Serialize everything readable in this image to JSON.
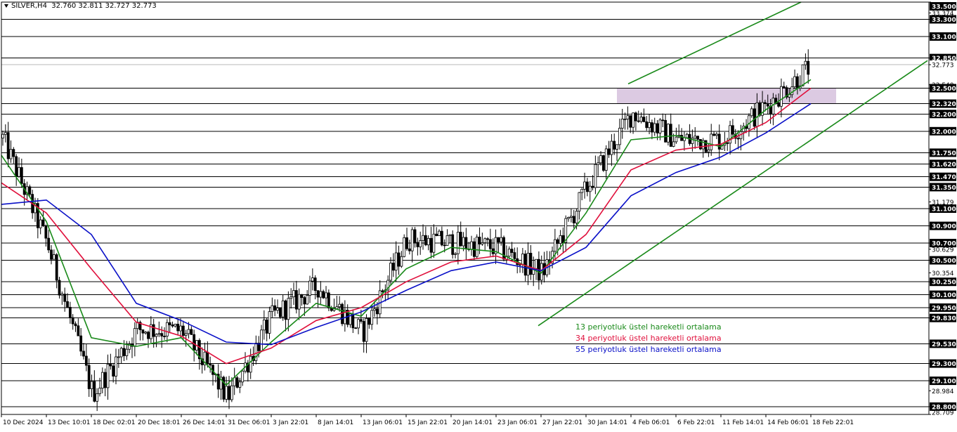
{
  "header": {
    "symbol_timeframe": "SILVER,H4",
    "ohlc": "32.760 32.811 32.727 32.773"
  },
  "legend": [
    {
      "label": "13 periyotluk üstel hareketli ortalama",
      "color": "#1a8a1a"
    },
    {
      "label": "34 periyotluk üstel hareketli ortalama",
      "color": "#e0103c"
    },
    {
      "label": "55 periyotluk üstel hareketli ortalama",
      "color": "#0a10c8"
    }
  ],
  "chart_data": {
    "type": "line",
    "title": "SILVER,H4",
    "ylim": [
      28.709,
      33.5
    ],
    "y_tick_labels": [
      "33.500",
      "33.374",
      "33.300",
      "33.100",
      "32.850",
      "32.773",
      "32.540",
      "32.500",
      "32.320",
      "32.200",
      "32.000",
      "31.750",
      "31.620",
      "31.470",
      "31.350",
      "31.179",
      "31.100",
      "30.900",
      "30.700",
      "30.629",
      "30.500",
      "30.354",
      "30.250",
      "30.100",
      "29.950",
      "29.830",
      "29.530",
      "29.300",
      "29.100",
      "28.984",
      "28.800",
      "28.709"
    ],
    "horizontal_levels": [
      33.5,
      33.3,
      33.1,
      32.85,
      32.5,
      32.32,
      32.2,
      32.0,
      31.75,
      31.62,
      31.47,
      31.35,
      31.1,
      30.9,
      30.7,
      30.5,
      30.25,
      30.1,
      29.95,
      29.83,
      29.53,
      29.3,
      29.1,
      28.8
    ],
    "current_price": 32.773,
    "x_tick_labels": [
      "10 Dec 2024",
      "13 Dec 10:01",
      "18 Dec 02:01",
      "20 Dec 18:01",
      "26 Dec 14:01",
      "31 Dec 06:01",
      "3 Jan 22:01",
      "8 Jan 14:01",
      "13 Jan 06:01",
      "15 Jan 22:01",
      "20 Jan 14:01",
      "23 Jan 06:01",
      "27 Jan 22:01",
      "30 Jan 14:01",
      "4 Feb 06:01",
      "6 Feb 22:01",
      "11 Feb 14:01",
      "14 Feb 06:01",
      "18 Feb 22:01"
    ],
    "resistance_zone": {
      "from": 32.32,
      "to": 32.5,
      "start": "4 Feb 06:01",
      "end": "18 Feb 22:01",
      "color": "#d8c4df"
    },
    "price_path": [
      [
        "10 Dec 2024",
        31.92
      ],
      [
        "13 Dec 10:01",
        30.68
      ],
      [
        "18 Dec 02:01",
        28.95
      ],
      [
        "20 Dec 18:01",
        29.7
      ],
      [
        "26 Dec 14:01",
        29.68
      ],
      [
        "31 Dec 06:01",
        28.9
      ],
      [
        "3 Jan 22:01",
        29.85
      ],
      [
        "8 Jan 14:01",
        30.2
      ],
      [
        "13 Jan 06:01",
        29.65
      ],
      [
        "15 Jan 22:01",
        30.75
      ],
      [
        "20 Jan 14:01",
        30.7
      ],
      [
        "23 Jan 06:01",
        30.65
      ],
      [
        "27 Jan 22:01",
        30.35
      ],
      [
        "30 Jan 14:01",
        31.35
      ],
      [
        "4 Feb 06:01",
        32.22
      ],
      [
        "6 Feb 22:01",
        31.9
      ],
      [
        "11 Feb 14:01",
        31.9
      ],
      [
        "14 Feb 06:01",
        32.3
      ],
      [
        "18 Feb 22:01",
        32.773
      ]
    ],
    "series": [
      {
        "name": "13 periyotluk üstel hareketli ortalama",
        "color": "#1a8a1a",
        "values": [
          31.72,
          30.95,
          29.6,
          29.5,
          29.6,
          29.05,
          29.55,
          30.0,
          29.85,
          30.4,
          30.65,
          30.6,
          30.35,
          31.05,
          31.9,
          31.95,
          31.82,
          32.25,
          32.6
        ]
      },
      {
        "name": "34 periyotluk üstel hareketli ortalama",
        "color": "#e0103c",
        "values": [
          31.4,
          31.05,
          30.4,
          29.78,
          29.62,
          29.3,
          29.48,
          29.8,
          29.95,
          30.25,
          30.48,
          30.55,
          30.38,
          30.8,
          31.55,
          31.78,
          31.85,
          32.1,
          32.5
        ]
      },
      {
        "name": "55 periyotluk üstel hareketli ortalama",
        "color": "#0a10c8",
        "values": [
          31.15,
          31.2,
          30.8,
          30.0,
          29.8,
          29.55,
          29.52,
          29.72,
          29.9,
          30.15,
          30.38,
          30.48,
          30.38,
          30.65,
          31.25,
          31.52,
          31.7,
          31.98,
          32.32
        ]
      }
    ],
    "trendlines": [
      {
        "name": "channel-lower",
        "color": "#1a8a1a",
        "from": [
          "27 Jan 22:01",
          29.74
        ],
        "to": [
          "18 Feb 22:01",
          32.82
        ]
      },
      {
        "name": "channel-upper",
        "color": "#1a8a1a",
        "from": [
          "4 Feb 06:01",
          32.55
        ],
        "to": [
          "14 Feb 06:01",
          33.5
        ]
      }
    ],
    "grid": false
  }
}
